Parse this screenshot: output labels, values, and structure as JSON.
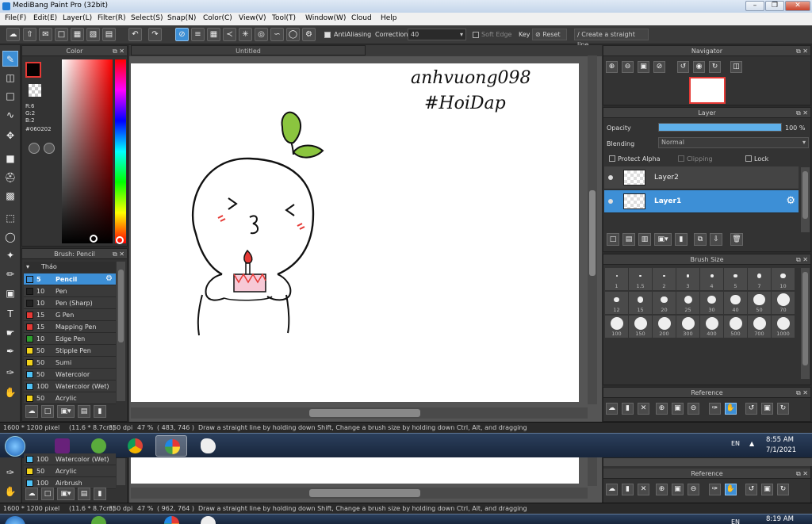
{
  "window": {
    "title": "MediBang Paint Pro (32bit)"
  },
  "menu": [
    "File(F)",
    "Edit(E)",
    "Layer(L)",
    "Filter(R)",
    "Select(S)",
    "Snap(N)",
    "Color(C)",
    "View(V)",
    "Tool(T)",
    "Window(W)",
    "Cloud",
    "Help"
  ],
  "toolbar": {
    "antialiasing": "AntiAliasing",
    "correction_label": "Correction",
    "correction_value": "40",
    "soft_edge": "Soft Edge",
    "key_label": "Key",
    "reset": "Reset",
    "straight_line": "Create a straight line"
  },
  "color_panel": {
    "title": "Color",
    "r": "R:6",
    "g": "G:2",
    "b": "B:2",
    "hex": "#060202",
    "primary_color": "#060202"
  },
  "brush_panel": {
    "title": "Brush: Pencil",
    "group": "Tháo",
    "items": [
      {
        "size": "5",
        "name": "Pencil",
        "color": "#3d8fd6",
        "selected": true
      },
      {
        "size": "10",
        "name": "Pen",
        "color": "#222222"
      },
      {
        "size": "10",
        "name": "Pen (Sharp)",
        "color": "#222222"
      },
      {
        "size": "15",
        "name": "G Pen",
        "color": "#e53935"
      },
      {
        "size": "15",
        "name": "Mapping Pen",
        "color": "#e53935"
      },
      {
        "size": "10",
        "name": "Edge Pen",
        "color": "#2e9e2e"
      },
      {
        "size": "50",
        "name": "Stipple Pen",
        "color": "#f2d31b"
      },
      {
        "size": "50",
        "name": "Sumi",
        "color": "#f2d31b"
      },
      {
        "size": "50",
        "name": "Watercolor",
        "color": "#4fc3f7"
      },
      {
        "size": "100",
        "name": "Watercolor (Wet)",
        "color": "#4fc3f7"
      },
      {
        "size": "50",
        "name": "Acrylic",
        "color": "#f2d31b"
      }
    ],
    "dup_items": [
      {
        "size": "100",
        "name": "Watercolor (Wet)",
        "color": "#4fc3f7"
      },
      {
        "size": "50",
        "name": "Acrylic",
        "color": "#f2d31b"
      },
      {
        "size": "100",
        "name": "Airbrush",
        "color": "#4fc3f7"
      }
    ]
  },
  "canvas": {
    "tab": "Untitled",
    "handwriting_line1": "anhvuong098",
    "handwriting_line2": "#HoiDap"
  },
  "navigator": {
    "title": "Navigator"
  },
  "layer_panel": {
    "title": "Layer",
    "opacity_label": "Opacity",
    "opacity_value": "100 %",
    "opacity_fraction": 1.0,
    "blending_label": "Blending",
    "blending_value": "Normal",
    "protect_alpha": "Protect Alpha",
    "clipping": "Clipping",
    "lock": "Lock",
    "layers": [
      {
        "name": "Layer2",
        "selected": false
      },
      {
        "name": "Layer1",
        "selected": true
      }
    ]
  },
  "brush_size_panel": {
    "title": "Brush Size",
    "sizes": [
      "1",
      "1.5",
      "2",
      "3",
      "4",
      "5",
      "7",
      "10",
      "12",
      "15",
      "20",
      "25",
      "30",
      "40",
      "50",
      "70",
      "100",
      "150",
      "200",
      "300",
      "400",
      "500",
      "700",
      "1000"
    ]
  },
  "reference_panel": {
    "title": "Reference"
  },
  "status1": {
    "dims": "1600 * 1200 pixel",
    "cm": "(11.6 * 8.7cm)",
    "dpi": "350 dpi",
    "zoom": "47 %",
    "coords": "( 483, 746 )",
    "hint": "Draw a straight line by holding down Shift, Change a brush size by holding down Ctrl, Alt, and dragging"
  },
  "status2": {
    "dims": "1600 * 1200 pixel",
    "cm": "(11.6 * 8.7cm)",
    "dpi": "350 dpi",
    "zoom": "47 %",
    "coords": "( 962, 764 )",
    "hint": "Draw a straight line by holding down Shift, Change a brush size by holding down Ctrl, Alt, and dragging"
  },
  "taskbar1": {
    "lang": "EN",
    "time": "8:55 AM",
    "date": "7/1/2021"
  },
  "taskbar2": {
    "lang": "EN",
    "time": "8:19 AM"
  }
}
